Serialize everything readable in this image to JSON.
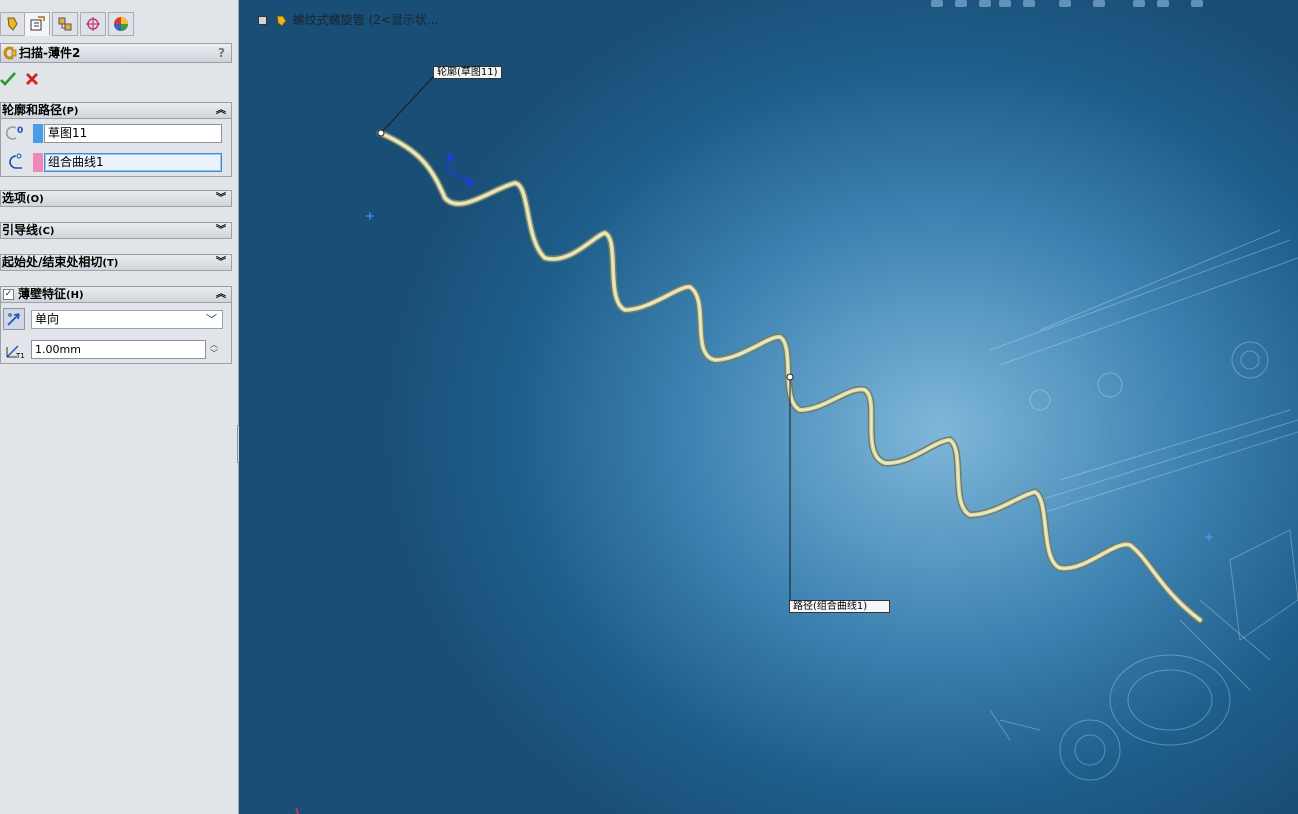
{
  "feature": {
    "title": "扫描-薄件2",
    "help": "?"
  },
  "actions": {
    "ok_icon": "checkmark-icon",
    "cancel_icon": "x-icon"
  },
  "sections": {
    "profile_path": {
      "label": "轮廓和路径",
      "key": "(P)",
      "profile_value": "草图11",
      "path_value": "组合曲线1",
      "profile_color": "#4a9ce8",
      "path_color": "#ee88b8"
    },
    "options": {
      "label": "选项",
      "key": "(O)"
    },
    "guides": {
      "label": "引导线",
      "key": "(C)"
    },
    "tangency": {
      "label": "起始处/结束处相切",
      "key": "(T)"
    },
    "thin": {
      "label": "薄壁特征",
      "key": "(H)",
      "checked": true,
      "direction": "单向",
      "thickness": "1.00mm"
    }
  },
  "viewport": {
    "tree_label": "螺纹式螺旋管 (2<显示状...",
    "callout_profile": "轮廓(草图11)",
    "callout_path": "路径(组合曲线1)",
    "accent_color": "#1b5f92"
  }
}
